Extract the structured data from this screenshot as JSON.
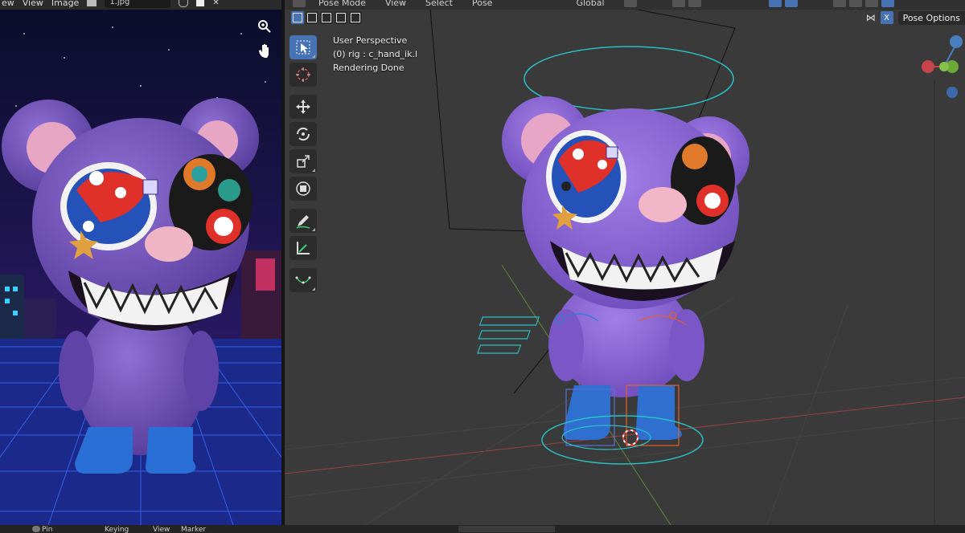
{
  "image_editor": {
    "menus": [
      "ew",
      "View",
      "Image"
    ],
    "image_name": "1.jpg"
  },
  "viewport": {
    "menus": [
      "Pose Mode",
      "View",
      "Select",
      "Pose"
    ],
    "transform_orientation": "Global",
    "info_lines": [
      "User Perspective",
      "(0) rig : c_hand_ik.l",
      "Rendering Done"
    ],
    "pose_options_label": "Pose Options",
    "close_label": "X",
    "gizmo_axes": {
      "y_label": "Y",
      "z_label": "Z"
    }
  },
  "bottom_bar": {
    "left_text": "Pin",
    "mid_text": "Keying",
    "mid_text_2": "View",
    "mid_text_3": "Marker"
  },
  "colors": {
    "accent": "#4772b3",
    "viewport_bg": "#3a3a3a",
    "bear_purple": "#7a5cc0",
    "x_axis": "#c8444b",
    "y_axis": "#6ea838",
    "z_axis": "#4a7fbf"
  }
}
